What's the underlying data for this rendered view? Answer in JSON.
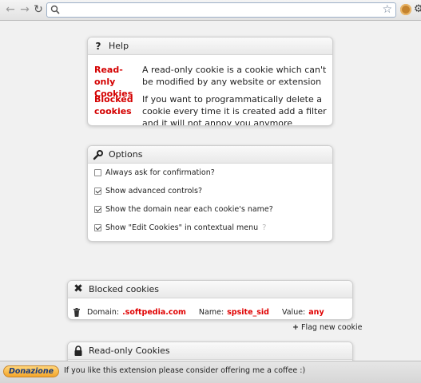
{
  "browser": {
    "back_icon": "back-arrow-icon",
    "forward_icon": "forward-arrow-icon",
    "reload_icon": "reload-icon",
    "omnibox_value": "",
    "star_icon": "star-icon",
    "extension_icon": "cookie-icon",
    "wrench_icon": "wrench-icon"
  },
  "help": {
    "title": "Help",
    "items": [
      {
        "term": "Read-only Cookies",
        "description": "A read-only cookie is a cookie which can't be modified by any website or extension"
      },
      {
        "term": "Blocked cookies",
        "description": "If you want to programmatically delete a cookie every time it is created add a filter and it will not annoy you anymore"
      }
    ]
  },
  "options": {
    "title": "Options",
    "items": [
      {
        "label": "Always ask for confirmation?",
        "checked": false
      },
      {
        "label": "Show advanced controls?",
        "checked": true
      },
      {
        "label": "Show the domain near each cookie's name?",
        "checked": true
      },
      {
        "label": "Show \"Edit Cookies\" in contextual menu",
        "checked": true,
        "hint": "?"
      }
    ]
  },
  "blocked": {
    "title": "Blocked cookies",
    "rule": {
      "domain_label": "Domain:",
      "domain_value": ".softpedia.com",
      "name_label": "Name:",
      "name_value": "spsite_sid",
      "value_label": "Value:",
      "value_value": "any"
    },
    "flag_link": "Flag new cookie"
  },
  "readonly": {
    "title": "Read-only Cookies"
  },
  "donation": {
    "button_label": "Donazione",
    "message": "If you like this extension please consider offering me a coffee :)"
  },
  "colors": {
    "accent_red": "#e00000",
    "donate_button": "#f4a52a"
  }
}
